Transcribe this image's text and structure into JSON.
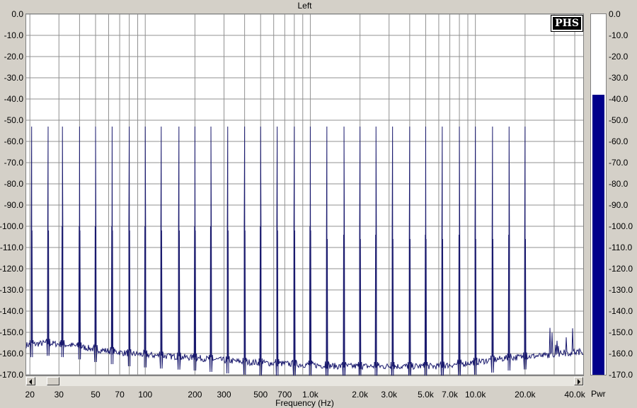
{
  "window": {
    "channel_title": "Left"
  },
  "branding": {
    "logo_text": "PHS"
  },
  "meter": {
    "label": "Pwr",
    "level_db": -38,
    "color": "#00008b"
  },
  "scrollbar": {
    "position": "left"
  },
  "chart_data": {
    "type": "line",
    "title": "Left",
    "xlabel": "Frequency (Hz)",
    "ylabel": "",
    "x_scale": "log",
    "xlim": [
      19,
      45000
    ],
    "ylim": [
      -170,
      0
    ],
    "y_ticks": [
      "0.0",
      "-10.0",
      "-20.0",
      "-30.0",
      "-40.0",
      "-50.0",
      "-60.0",
      "-70.0",
      "-80.0",
      "-90.0",
      "-100.0",
      "-110.0",
      "-120.0",
      "-130.0",
      "-140.0",
      "-150.0",
      "-160.0",
      "-170.0"
    ],
    "x_ticks": [
      {
        "v": 20,
        "label": "20"
      },
      {
        "v": 30,
        "label": "30"
      },
      {
        "v": 50,
        "label": "50"
      },
      {
        "v": 70,
        "label": "70"
      },
      {
        "v": 100,
        "label": "100"
      },
      {
        "v": 200,
        "label": "200"
      },
      {
        "v": 300,
        "label": "300"
      },
      {
        "v": 500,
        "label": "500"
      },
      {
        "v": 700,
        "label": "700"
      },
      {
        "v": 1000,
        "label": "1.0k"
      },
      {
        "v": 2000,
        "label": "2.0k"
      },
      {
        "v": 3000,
        "label": "3.0k"
      },
      {
        "v": 5000,
        "label": "5.0k"
      },
      {
        "v": 7000,
        "label": "7.0k"
      },
      {
        "v": 10000,
        "label": "10.0k"
      },
      {
        "v": 20000,
        "label": "20.0k"
      },
      {
        "v": 40000,
        "label": "40.0k"
      }
    ],
    "grid": true,
    "line_color": "#1a1a6e",
    "peak_level_db": -53,
    "peak_frequencies_hz": [
      20.5,
      25.8,
      31.5,
      40,
      50,
      63,
      80,
      100,
      125,
      160,
      200,
      250,
      316,
      400,
      500,
      630,
      800,
      1000,
      1260,
      1600,
      2000,
      2500,
      3150,
      4000,
      5000,
      6300,
      8000,
      10000,
      12700,
      16000,
      20000
    ],
    "noise_floor": [
      {
        "f": 19,
        "db": -156
      },
      {
        "f": 25,
        "db": -155
      },
      {
        "f": 35,
        "db": -156
      },
      {
        "f": 50,
        "db": -158
      },
      {
        "f": 80,
        "db": -160
      },
      {
        "f": 120,
        "db": -161
      },
      {
        "f": 200,
        "db": -162
      },
      {
        "f": 400,
        "db": -164
      },
      {
        "f": 800,
        "db": -165
      },
      {
        "f": 1500,
        "db": -166
      },
      {
        "f": 3000,
        "db": -166
      },
      {
        "f": 6000,
        "db": -166
      },
      {
        "f": 10000,
        "db": -164
      },
      {
        "f": 16000,
        "db": -162
      },
      {
        "f": 25000,
        "db": -161
      },
      {
        "f": 45000,
        "db": -159
      }
    ]
  }
}
